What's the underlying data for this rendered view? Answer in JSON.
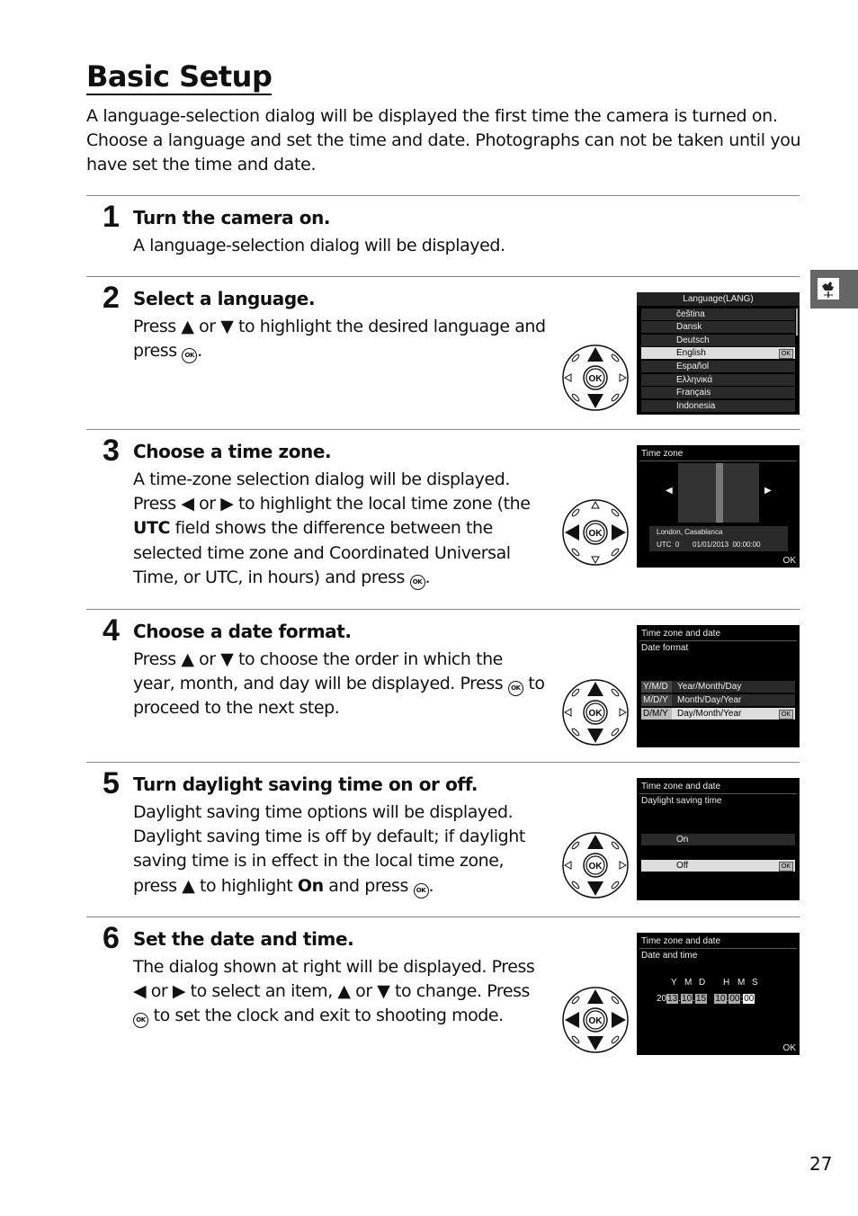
{
  "page": {
    "title": "Basic Setup",
    "intro": "A language-selection dialog will be displayed the first time the camera is turned on. Choose a language and set the time and date.  Photographs can not be taken until you have set the time and date.",
    "page_number": "27",
    "side_tab_icon": "setup-menu-weathervane-icon"
  },
  "steps": [
    {
      "number": "1",
      "title": "Turn the camera on.",
      "body": [
        "A language-selection dialog will be displayed."
      ]
    },
    {
      "number": "2",
      "title": "Select a language.",
      "body": [
        "Press ▲ or ▼ to highlight the desired language and press ",
        "."
      ]
    },
    {
      "number": "3",
      "title": "Choose a time zone.",
      "body": [
        "A time-zone selection dialog will be displayed. Press ◀ or ▶ to highlight the local time zone (the ",
        "UTC",
        " field shows the difference between the selected time zone and Coordinated Universal Time, or UTC, in hours) and press ",
        "."
      ]
    },
    {
      "number": "4",
      "title": "Choose a date format.",
      "body": [
        "Press ▲ or ▼ to choose the order in which the year, month, and day will be displayed.  Press ",
        " to proceed to the next step."
      ]
    },
    {
      "number": "5",
      "title": "Turn daylight saving time on or off.",
      "body": [
        "Daylight saving time options will be displayed. Daylight saving time is off by default; if daylight saving time is in effect in the local time zone, press ▲ to highlight ",
        "On",
        " and press ",
        "."
      ]
    },
    {
      "number": "6",
      "title": "Set the date and time.",
      "body": [
        "The dialog shown at right will be displayed.  Press ◀ or ▶ to select an item, ▲ or ▼ to change.  Press ",
        " to set the clock and exit to shooting mode."
      ]
    }
  ],
  "ok_symbol": "OK",
  "screens": {
    "language": {
      "header": "Language(LANG)",
      "items": [
        "čeština",
        "Dansk",
        "Deutsch",
        "English",
        "Español",
        "Ελληνικά",
        "Français",
        "Indonesia"
      ],
      "selected": "English",
      "ok": "OK"
    },
    "timezone": {
      "header": "Time zone",
      "city": "London, Casablanca",
      "utc": "UTC  0",
      "datetime": "01/01/2013  00:00:00",
      "ok": "OK"
    },
    "dateformat": {
      "header": "Time zone and date",
      "subheader": "Date format",
      "items": [
        {
          "code": "Y/M/D",
          "label": "Year/Month/Day"
        },
        {
          "code": "M/D/Y",
          "label": "Month/Day/Year"
        },
        {
          "code": "D/M/Y",
          "label": "Day/Month/Year"
        }
      ],
      "selected": "D/M/Y",
      "ok": "OK"
    },
    "dst": {
      "header": "Time zone and date",
      "subheader": "Daylight saving time",
      "items": [
        "On",
        "Off"
      ],
      "selected": "Off",
      "ok": "OK"
    },
    "datetime": {
      "header": "Time zone and date",
      "subheader": "Date and time",
      "labels": [
        "Y",
        "M",
        "D",
        "H",
        "M",
        "S"
      ],
      "year_prefix": "20",
      "values": [
        "13",
        "10",
        "15",
        "10",
        "00",
        "00"
      ],
      "selected_field": "S",
      "ok": "OK"
    }
  }
}
